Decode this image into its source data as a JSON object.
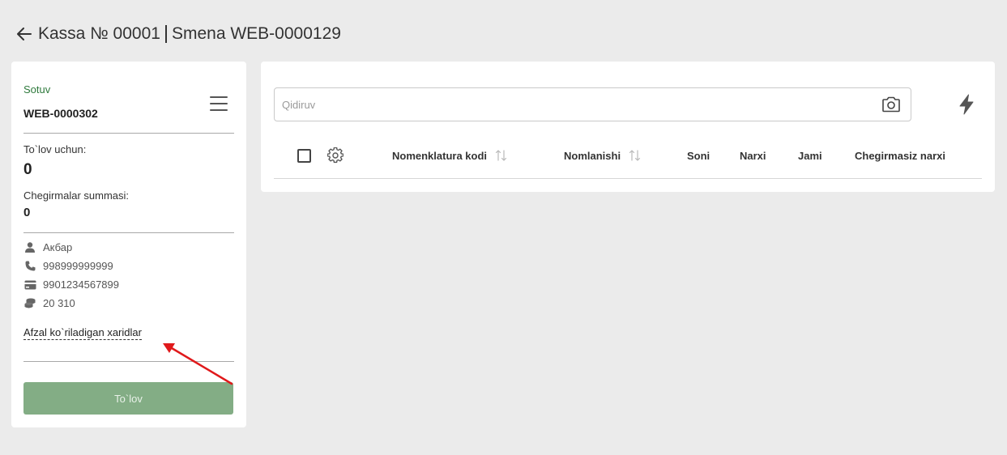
{
  "header": {
    "kassa": "Kassa № 00001",
    "smena": "Smena WEB-0000129"
  },
  "sidebar": {
    "mode": "Sotuv",
    "doc_number": "WEB-0000302",
    "pay_label": "To`lov uchun:",
    "pay_amount": "0",
    "discount_label": "Chegirmalar summasi:",
    "discount_amount": "0",
    "customer": {
      "name": "Акбар",
      "phone": "998999999999",
      "card": "9901234567899",
      "balance": "20 310"
    },
    "favorites_link": "Afzal ko`riladigan xaridlar",
    "pay_button": "To`lov"
  },
  "search": {
    "placeholder": "Qidiruv",
    "value": ""
  },
  "table": {
    "columns": [
      "Nomenklatura kodi",
      "Nomlanishi",
      "Soni",
      "Narxi",
      "Jami",
      "Chegirmasiz narxi"
    ]
  },
  "colors": {
    "accent_green": "#2f7a3d",
    "button_green": "#83ad85",
    "annotation_arrow": "#e0191b"
  }
}
